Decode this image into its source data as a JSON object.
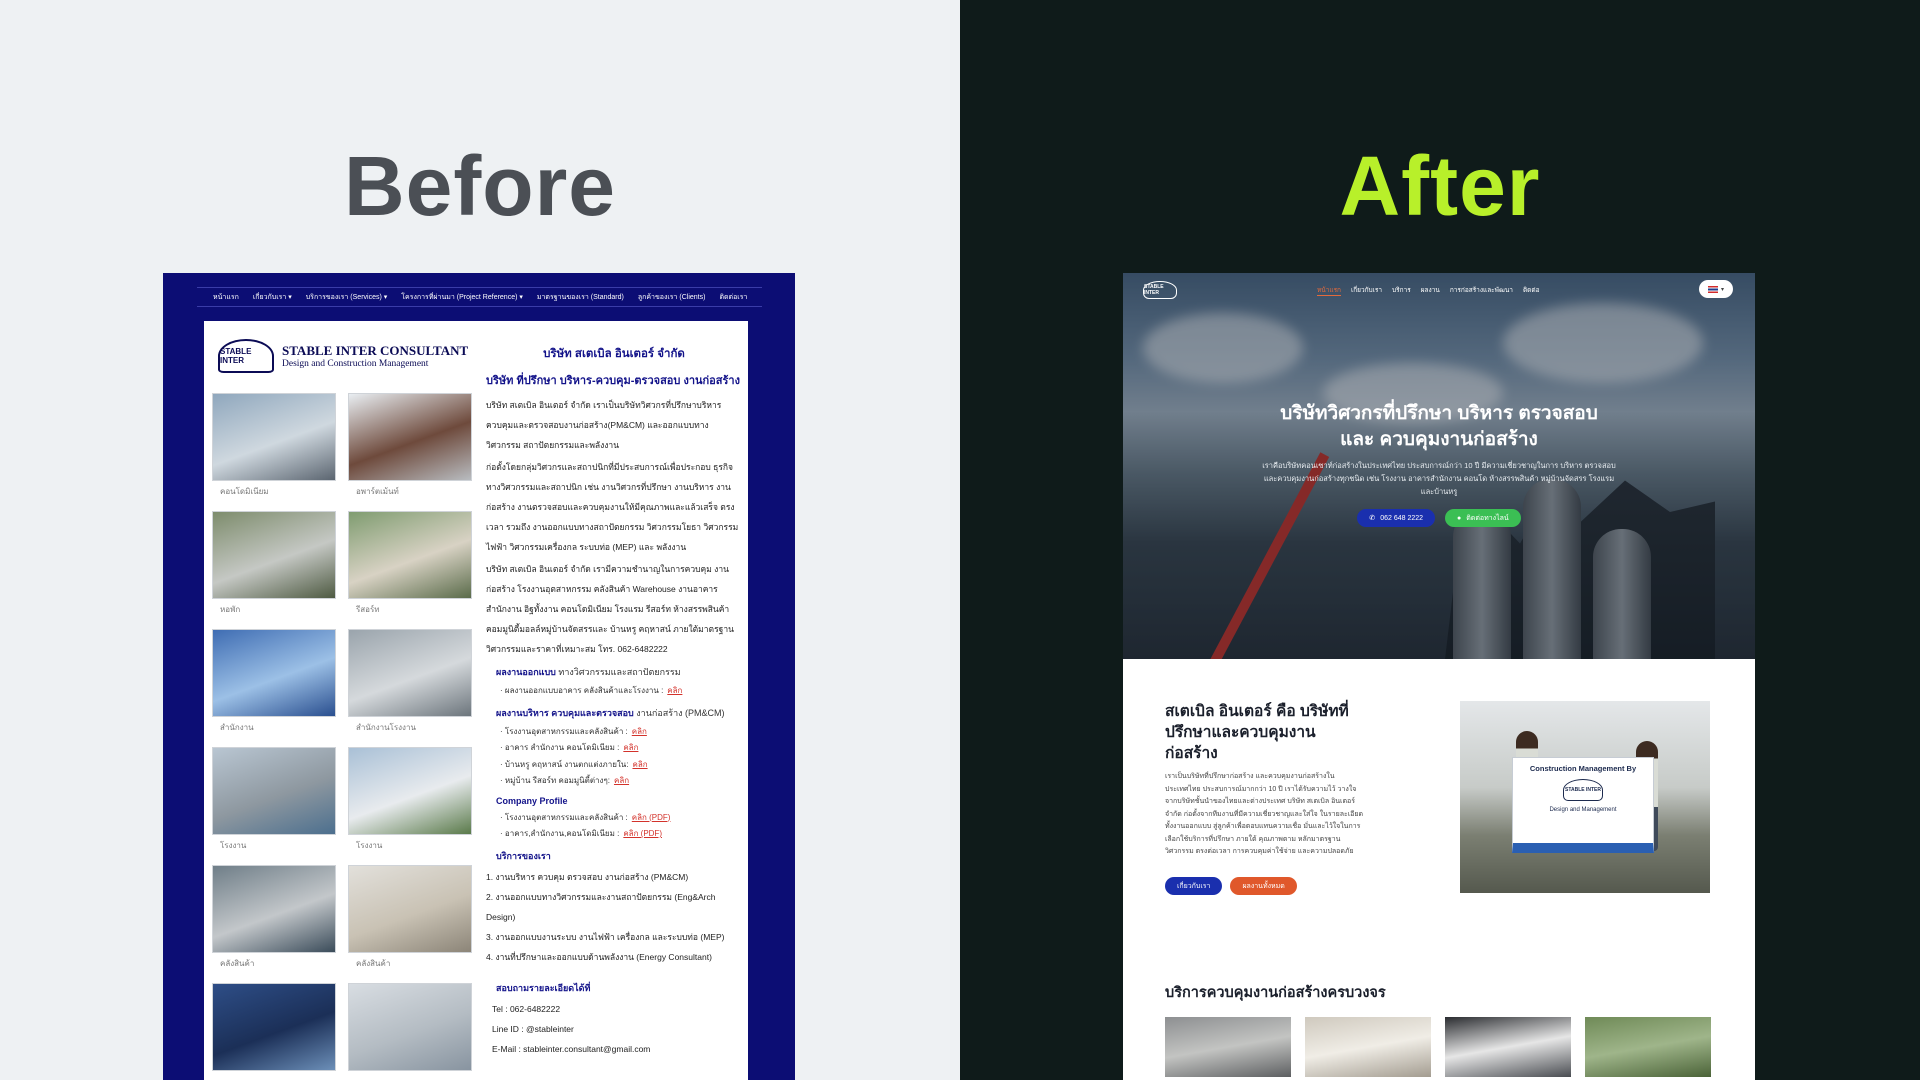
{
  "before": {
    "heading": "Before",
    "nav": [
      "หน้าแรก",
      "เกี่ยวกับเรา ▾",
      "บริการของเรา (Services) ▾",
      "โครงการที่ผ่านมา (Project Reference) ▾",
      "มาตรฐานของเรา (Standard)",
      "ลูกค้าของเรา (Clients)",
      "ติดต่อเรา"
    ],
    "logo": {
      "mark": "STABLE INTER",
      "title": "STABLE INTER CONSULTANT",
      "subtitle": "Design and Construction Management"
    },
    "gallery": [
      {
        "caption": "คอนโดมิเนียม",
        "colors": [
          "#8fa7bd",
          "#cfd8df",
          "#5b6570"
        ]
      },
      {
        "caption": "อพาร์ตเม้นท์",
        "colors": [
          "#e9eef2",
          "#6e4a3c",
          "#b8bcc0"
        ]
      },
      {
        "caption": "หอพัก",
        "colors": [
          "#7d8c6c",
          "#c5c8c4",
          "#4e5a42"
        ]
      },
      {
        "caption": "รีสอร์ท",
        "colors": [
          "#7f9c70",
          "#d8d2c4",
          "#5a6b4a"
        ]
      },
      {
        "caption": "สำนักงาน",
        "colors": [
          "#3f6db3",
          "#9cc0e6",
          "#2a4f8f"
        ]
      },
      {
        "caption": "สำนักงานโรงงาน",
        "colors": [
          "#9aa4ac",
          "#d5d9dc",
          "#6c757c"
        ]
      },
      {
        "caption": "โรงงาน",
        "colors": [
          "#b9c6d2",
          "#8e98a0",
          "#4c6f8e"
        ]
      },
      {
        "caption": "โรงงาน",
        "colors": [
          "#a9c0d6",
          "#e8ebee",
          "#5a7a4a"
        ]
      },
      {
        "caption": "คลังสินค้า",
        "colors": [
          "#6f7e88",
          "#c3c7ca",
          "#3b4c5a"
        ]
      },
      {
        "caption": "คลังสินค้า",
        "colors": [
          "#e2e0db",
          "#c9c2b4",
          "#8c8578"
        ]
      },
      {
        "caption": "",
        "colors": [
          "#2e4e87",
          "#1b2f57",
          "#6c8fb8"
        ]
      },
      {
        "caption": "",
        "colors": [
          "#d8dde2",
          "#b4bcc3",
          "#8894a0"
        ]
      }
    ],
    "text": {
      "company": "บริษัท สเตเบิล อินเตอร์ จำกัด",
      "tagline": "บริษัท ที่ปรึกษา บริหาร-ควบคุม-ตรวจสอบ งานก่อสร้าง",
      "p1": "บริษัท สเตเบิล อินเตอร์ จำกัด เราเป็นบริษัทวิศวกรที่ปรึกษาบริหาร ควบคุมและตรวจสอบงานก่อสร้าง(PM&CM) และออกแบบทางวิศวกรรม สถาปัตยกรรมและพลังงาน",
      "p2": "ก่อตั้งโดยกลุ่มวิศวกรและสถาปนิกที่มีประสบการณ์เพื่อประกอบ ธุรกิจทางวิศวกรรมและสถาปนิก เช่น งานวิศวกรที่ปรึกษา งานบริหาร งานก่อสร้าง งานตรวจสอบและควบคุมงานให้มีคุณภาพและแล้วเสร็จ ตรงเวลา รวมถึง งานออกแบบทางสถาปัตยกรรม วิศวกรรมโยธา วิศวกรรมไฟฟ้า วิศวกรรมเครื่องกล ระบบท่อ (MEP) และ พลังงาน",
      "p3": "บริษัท สเตเบิล อินเตอร์ จำกัด เรามีความชำนาญในการควบคุม งานก่อสร้าง โรงงานอุตสาหกรรม คลังสินค้า Warehouse งานอาคาร สำนักงาน อิฐทั้งงาน คอนโดมิเนียม โรงแรม รีสอร์ท ห้างสรรพสินค้า คอมมูนิตี้มอลล์หมู่บ้านจัดสรรและ บ้านหรู คฤหาสน์ ภายใต้มาตรฐานวิศวกรรมและราคาที่เหมาะสม โทร. 062-6482222",
      "design_label": "ผลงานออกแบบ",
      "design_desc": "ทางวิศวกรรมและสถาปัตยกรรม",
      "design_items": [
        {
          "label": "ผลงานออกแบบอาคาร คลังสินค้าและโรงงาน :",
          "link": "คลิก"
        }
      ],
      "pmcm_label": "ผลงานบริหาร ควบคุมและตรวจสอบ",
      "pmcm_desc": "งานก่อสร้าง (PM&CM)",
      "pmcm_items": [
        {
          "label": "โรงงานอุตสาหกรรมและคลังสินค้า :",
          "link": "คลิก"
        },
        {
          "label": "อาคาร สำนักงาน คอนโดมิเนียม :",
          "link": "คลิก"
        },
        {
          "label": "บ้านหรู คฤหาสน์ งานตกแต่งภายใน:",
          "link": "คลิก"
        },
        {
          "label": "หมู่บ้าน รีสอร์ท คอมมูนิตี้ต่างๆ:",
          "link": "คลิก"
        }
      ],
      "profile_label": "Company Profile",
      "profile_items": [
        {
          "label": "โรงงานอุตสาหกรรมและคลังสินค้า :",
          "link": "คลิก (PDF)"
        },
        {
          "label": "อาคาร,สำนักงาน,คอนโดมิเนียม :",
          "link": "คลิก (PDF)"
        }
      ],
      "services_label": "บริการของเรา",
      "services": [
        "1. งานบริหาร ควบคุม ตรวจสอบ งานก่อสร้าง (PM&CM)",
        "2. งานออกแบบทางวิศวกรรมและงานสถาปัตยกรรม (Eng&Arch Design)",
        "3. งานออกแบบงานระบบ งานไฟฟ้า เครื่องกล และระบบท่อ (MEP)",
        "4. งานที่ปรึกษาและออกแบบด้านพลังงาน (Energy Consultant)"
      ],
      "contact_label": "สอบถามรายละเอียดได้ที่",
      "tel": "Tel   : 062-6482222",
      "line": "Line ID : @stableinter",
      "email": "E-Mail : stableinter.consultant@gmail.com"
    }
  },
  "after": {
    "heading": "After",
    "logo_mark": "STABLE INTER",
    "nav": [
      "หน้าแรก",
      "เกี่ยวกับเรา",
      "บริการ",
      "ผลงาน",
      "การก่อสร้างและพัฒนา",
      "ติดต่อ"
    ],
    "hero_title_1": "บริษัทวิศวกรที่ปรึกษา บริหาร ตรวจสอบ",
    "hero_title_2": "และ ควบคุมงานก่อสร้าง",
    "hero_desc": "เราคือบริษัทคอนเซาท์ก่อสร้างในประเทศไทย ประสบการณ์กว่า 10 ปี มีความเชี่ยวชาญในการ บริหาร ตรวจสอบ และควบคุมงานก่อสร้างทุกชนิด เช่น โรงงาน อาคารสำนักงาน คอนโด ห้างสรรพสินค้า หมู่บ้านจัดสรร โรงแรม และบ้านหรู",
    "phone_btn": "062 648 2222",
    "line_btn": "ติดต่อทางไลน์",
    "about_title": "สเตเบิล อินเตอร์ คือ บริษัทที่ปรึกษาและควบคุมงานก่อสร้าง",
    "about_desc": "เราเป็นบริษัทที่ปรึกษาก่อสร้าง และควบคุมงานก่อสร้างใน ประเทศไทย ประสบการณ์มากกว่า 10 ปี เราได้รับความไว้ วางใจจากบริษัทชั้นนำของไทยและต่างประเทศ บริษัท สเตเบิล อินเตอร์ จำกัด ก่อตั้งจากทีมงานที่มีความเชี่ยวชาญและใส่ใจ ในรายละเอียดทั้งงานออกแบบ สู่ลูกค้าเพื่อตอบแทนความเชื่อ มั่นและไว้ใจในการเลือกใช้บริการที่ปรึกษา ภายใต้ คุณภาพตาม หลักมาตรฐานวิศวกรรม ตรงต่อเวลา การควบคุมค่าใช้จ่าย และความปลอดภัย",
    "about_btn_1": "เกี่ยวกับเรา",
    "about_btn_2": "ผลงานทั้งหมด",
    "banner_title": "Construction Management By",
    "banner_mark": "STABLE INTER",
    "banner_sub": "Design and Management",
    "services_title": "บริการควบคุมงานก่อสร้างครบวงจร",
    "service_images": [
      {
        "colors": [
          "#8d8f91",
          "#c3c4c2",
          "#5d5f61"
        ]
      },
      {
        "colors": [
          "#cfc9be",
          "#f0ede6",
          "#a39c90"
        ]
      },
      {
        "colors": [
          "#2a2c30",
          "#e6e6e6",
          "#4a4d52"
        ]
      },
      {
        "colors": [
          "#6f8a57",
          "#9fb58a",
          "#4b6338"
        ]
      }
    ]
  }
}
